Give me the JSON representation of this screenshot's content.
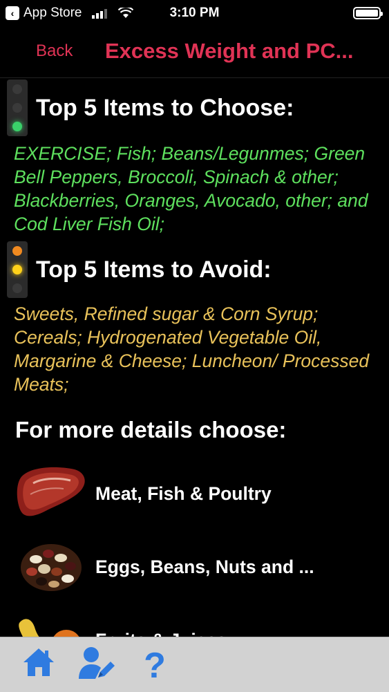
{
  "status_bar": {
    "carrier_back": "App Store",
    "time": "3:10 PM",
    "icons": [
      "back-arrow-icon",
      "signal-icon",
      "wifi-icon",
      "battery-icon"
    ]
  },
  "nav": {
    "back_label": "Back",
    "title": "Excess Weight and PC..."
  },
  "choose": {
    "heading": "Top 5 Items to Choose:",
    "items_text": "EXERCISE; Fish; Beans/Legunmes; Green Bell Peppers, Broccoli, Spinach & other; Blackberries, Oranges, Avocado, other; and Cod Liver Fish Oil;",
    "text_color": "#5ee05e"
  },
  "avoid": {
    "heading": "Top 5 Items to Avoid:",
    "items_text": "Sweets, Refined sugar & Corn Syrup; Cereals; Hydrogenated Vegetable Oil, Margarine & Cheese; Luncheon/ Processed Meats;",
    "text_color": "#e9c25a"
  },
  "details": {
    "heading": "For more details choose:",
    "categories": [
      {
        "label": "Meat, Fish & Poultry",
        "icon": "steak-icon"
      },
      {
        "label": "Eggs, Beans, Nuts and ...",
        "icon": "beans-icon"
      },
      {
        "label": "Fruits & Juices",
        "icon": "fruit-icon"
      }
    ]
  },
  "tab_bar": {
    "items": [
      "home-icon",
      "user-edit-icon",
      "help-icon"
    ],
    "icon_color": "#2f7be0"
  },
  "colors": {
    "accent": "#e03355",
    "background": "#000000",
    "tab_bar_bg": "#d2d2d2"
  }
}
